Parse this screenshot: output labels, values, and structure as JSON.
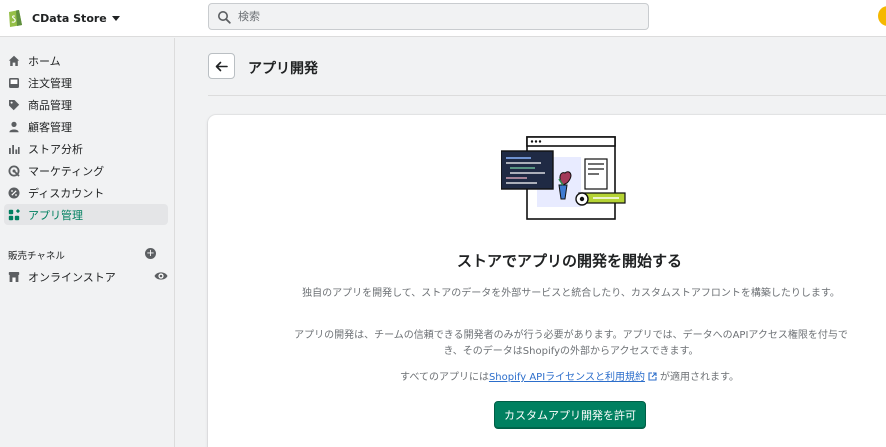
{
  "topbar": {
    "store_name": "CData Store",
    "search_placeholder": "検索"
  },
  "sidebar": {
    "items": [
      {
        "label": "ホーム",
        "icon": "home-icon"
      },
      {
        "label": "注文管理",
        "icon": "inbox-icon"
      },
      {
        "label": "商品管理",
        "icon": "tag-icon"
      },
      {
        "label": "顧客管理",
        "icon": "person-icon"
      },
      {
        "label": "ストア分析",
        "icon": "bar-chart-icon"
      },
      {
        "label": "マーケティング",
        "icon": "target-icon"
      },
      {
        "label": "ディスカウント",
        "icon": "discount-icon"
      },
      {
        "label": "アプリ管理",
        "icon": "apps-icon",
        "active": true
      }
    ],
    "sales_channels_title": "販売チャネル",
    "channels": [
      {
        "label": "オンラインストア",
        "icon": "store-icon"
      }
    ]
  },
  "page": {
    "title": "アプリ開発"
  },
  "card": {
    "heading": "ストアでアプリの開発を開始する",
    "paragraph1": "独自のアプリを開発して、ストアのデータを外部サービスと統合したり、カスタムストアフロントを構築したりします。",
    "paragraph2": "アプリの開発は、チームの信頼できる開発者のみが行う必要があります。アプリでは、データへのAPIアクセス権限を付与でき、そのデータはShopifyの外部からアクセスできます。",
    "license_prefix": "すべてのアプリには",
    "license_link": "Shopify APIライセンスと利用規約",
    "license_suffix": "が適用されます。",
    "button_label": "カスタムアプリ開発を許可"
  },
  "colors": {
    "primary": "#008060",
    "link": "#2c6ecb",
    "active_nav_text": "#008060"
  }
}
